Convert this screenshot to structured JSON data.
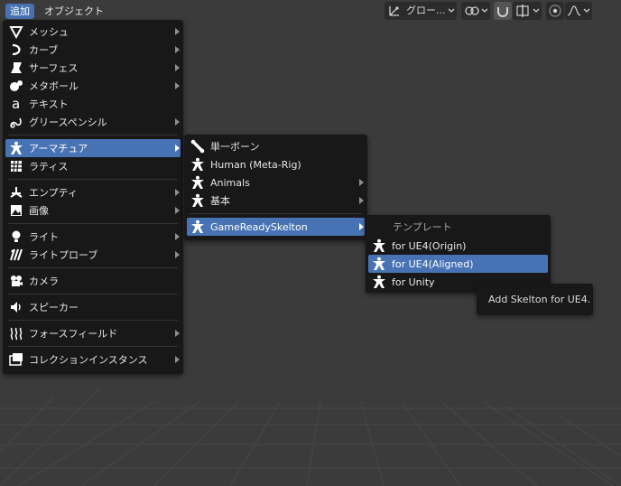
{
  "menubar": {
    "add": "追加",
    "object": "オブジェクト"
  },
  "header": {
    "transform_orientation": "グロー..."
  },
  "add_menu": [
    {
      "label": "メッシュ",
      "icon": "mesh-cone-icon",
      "arrow": true
    },
    {
      "label": "カーブ",
      "icon": "curve-icon",
      "arrow": true
    },
    {
      "label": "サーフェス",
      "icon": "surface-icon",
      "arrow": true
    },
    {
      "label": "メタボール",
      "icon": "metaball-icon",
      "arrow": true
    },
    {
      "label": "テキスト",
      "icon": "text-icon",
      "arrow": false
    },
    {
      "label": "グリースペンシル",
      "icon": "grease-pencil-icon",
      "arrow": true
    },
    {
      "label": "アーマチュア",
      "icon": "armature-icon",
      "arrow": true,
      "highlighted": true
    },
    {
      "label": "ラティス",
      "icon": "lattice-icon",
      "arrow": false
    },
    {
      "label": "エンプティ",
      "icon": "empty-icon",
      "arrow": true
    },
    {
      "label": "画像",
      "icon": "image-icon",
      "arrow": true
    },
    {
      "label": "ライト",
      "icon": "light-icon",
      "arrow": true
    },
    {
      "label": "ライトプローブ",
      "icon": "light-probe-icon",
      "arrow": true
    },
    {
      "label": "カメラ",
      "icon": "camera-icon",
      "arrow": false
    },
    {
      "label": "スピーカー",
      "icon": "speaker-icon",
      "arrow": false
    },
    {
      "label": "フォースフィールド",
      "icon": "force-field-icon",
      "arrow": true
    },
    {
      "label": "コレクションインスタンス",
      "icon": "collection-instance-icon",
      "arrow": true
    }
  ],
  "armature_menu": [
    {
      "label": "単一ボーン",
      "icon": "bone-icon",
      "arrow": false
    },
    {
      "label": "Human (Meta-Rig)",
      "icon": "armature-icon",
      "arrow": false
    },
    {
      "label": "Animals",
      "icon": "armature-icon",
      "arrow": true
    },
    {
      "label": "基本",
      "icon": "armature-icon",
      "arrow": true
    },
    {
      "label": "GameReadySkelton",
      "icon": "armature-icon",
      "arrow": true,
      "highlighted": true
    }
  ],
  "gameready_menu": {
    "header": "テンプレート",
    "items": [
      {
        "label": "for UE4(Origin)",
        "icon": "armature-icon"
      },
      {
        "label": "for UE4(Aligned)",
        "icon": "armature-icon",
        "highlighted": true
      },
      {
        "label": "for Unity",
        "icon": "armature-icon"
      }
    ]
  },
  "tooltip": "Add Skelton for UE4.",
  "colors": {
    "background": "#3b3b3b",
    "menu": "#181818",
    "highlight": "#4772b3",
    "grid": "#4a4a4a"
  }
}
